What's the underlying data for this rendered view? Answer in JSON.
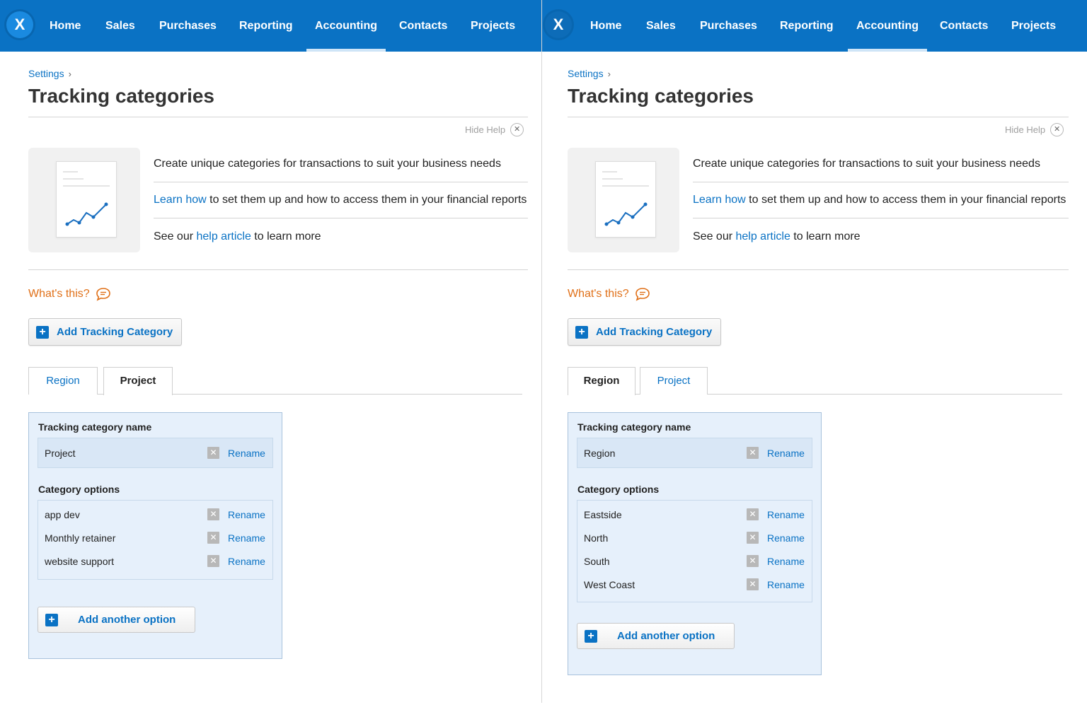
{
  "left": {
    "nav": {
      "logo": "X",
      "items": [
        "Home",
        "Sales",
        "Purchases",
        "Reporting",
        "Accounting",
        "Contacts",
        "Projects"
      ],
      "active": "Accounting"
    },
    "breadcrumb": {
      "label": "Settings",
      "separator": "›"
    },
    "title": "Tracking categories",
    "help": {
      "hide_label": "Hide Help",
      "line1": "Create unique categories for transactions to suit your business needs",
      "line2_link": "Learn how",
      "line2_text": " to set them up and how to access them in your financial reports",
      "line3_prefix": "See our ",
      "line3_link": "help article",
      "line3_suffix": " to learn more"
    },
    "whats_this": "What's this?",
    "add_category_label": "Add Tracking Category",
    "tabs": [
      "Region",
      "Project"
    ],
    "active_tab": "Project",
    "box": {
      "name_label": "Tracking category name",
      "name_value": "Project",
      "options_label": "Category options",
      "options": [
        "app dev",
        "Monthly retainer",
        "website support"
      ],
      "rename_label": "Rename",
      "add_option_label": "Add another option"
    }
  },
  "right": {
    "nav": {
      "logo": "X",
      "items": [
        "Home",
        "Sales",
        "Purchases",
        "Reporting",
        "Accounting",
        "Contacts",
        "Projects"
      ],
      "active": "Accounting"
    },
    "breadcrumb": {
      "label": "Settings",
      "separator": "›"
    },
    "title": "Tracking categories",
    "help": {
      "hide_label": "Hide Help",
      "line1": "Create unique categories for transactions to suit your business needs",
      "line2_link": "Learn how",
      "line2_text": " to set them up and how to access them in your financial reports",
      "line3_prefix": "See our ",
      "line3_link": "help article",
      "line3_suffix": " to learn more"
    },
    "whats_this": "What's this?",
    "add_category_label": "Add Tracking Category",
    "tabs": [
      "Region",
      "Project"
    ],
    "active_tab": "Region",
    "box": {
      "name_label": "Tracking category name",
      "name_value": "Region",
      "options_label": "Category options",
      "options": [
        "Eastside",
        "North",
        "South",
        "West Coast"
      ],
      "rename_label": "Rename",
      "add_option_label": "Add another option"
    }
  },
  "colors": {
    "nav_bg": "#0a72c4",
    "link": "#0a72c4",
    "accent_orange": "#e07018",
    "box_bg": "#e6f0fb"
  },
  "icons": {
    "logo": "xero-logo-icon",
    "hide_help": "close-circle-icon",
    "whats_this": "speech-bubble-icon",
    "add": "plus-icon",
    "delete": "delete-x-icon",
    "help_illustration": "document-chart-icon"
  }
}
